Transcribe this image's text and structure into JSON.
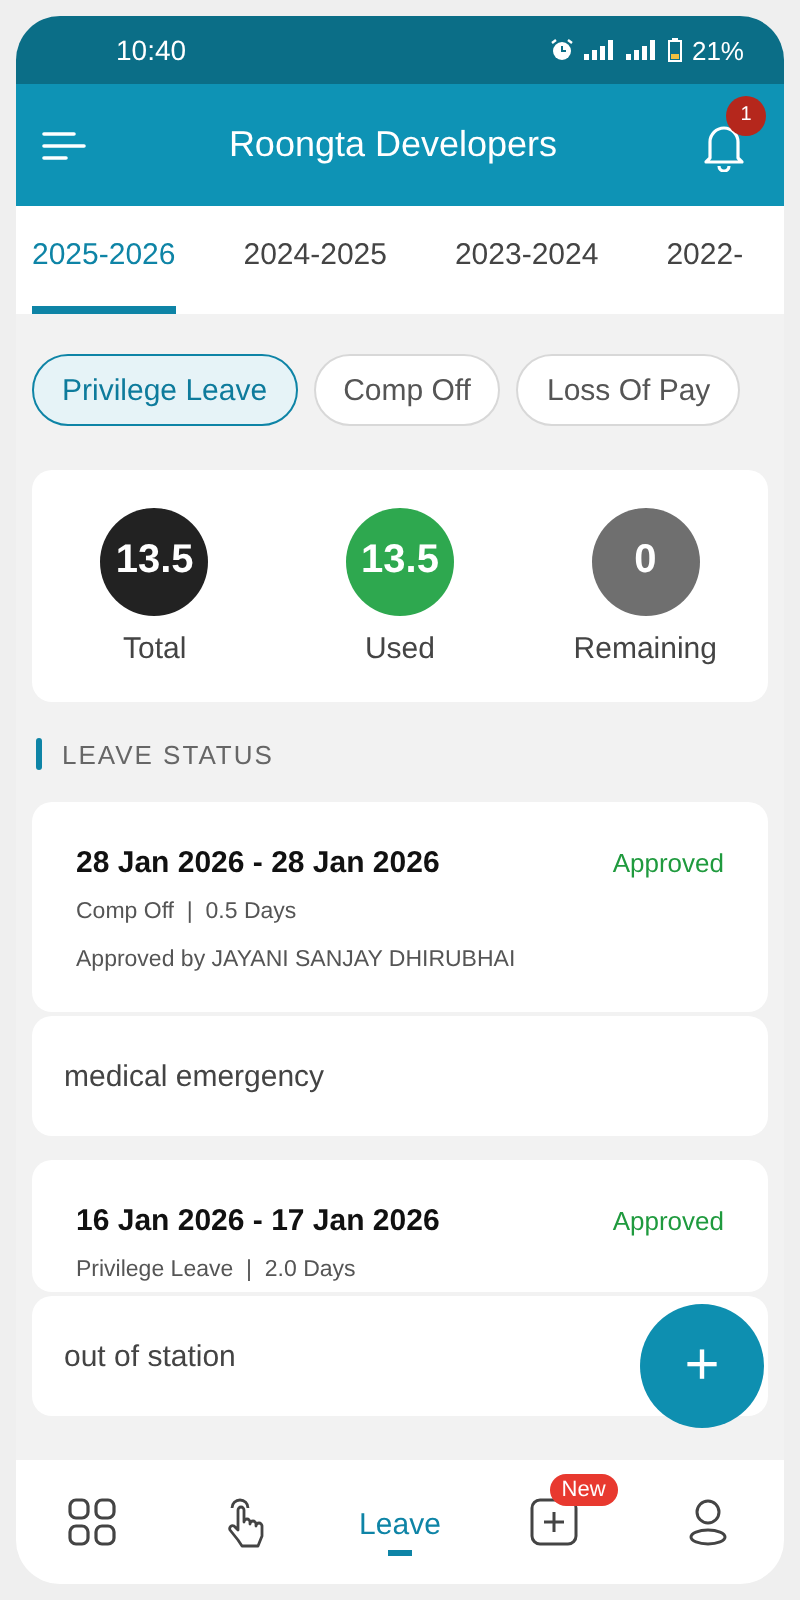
{
  "status_bar": {
    "time": "10:40",
    "battery": "21%"
  },
  "app_bar": {
    "title": "Roongta Developers",
    "notification_count": "1"
  },
  "tabs": [
    {
      "label": "2025-2026",
      "selected": true
    },
    {
      "label": "2024-2025",
      "selected": false
    },
    {
      "label": "2023-2024",
      "selected": false
    },
    {
      "label": "2022-",
      "selected": false
    }
  ],
  "filters": [
    {
      "label": "Privilege Leave",
      "selected": true
    },
    {
      "label": "Comp Off",
      "selected": false
    },
    {
      "label": "Loss Of Pay",
      "selected": false
    }
  ],
  "summary": [
    {
      "value": "13.5",
      "label": "Total",
      "color": "#222222"
    },
    {
      "value": "13.5",
      "label": "Used",
      "color": "#2ea84f"
    },
    {
      "value": "0",
      "label": "Remaining",
      "color": "#6f6f6f"
    }
  ],
  "section_title": "LEAVE STATUS",
  "leaves": [
    {
      "dates": "28 Jan 2026 - 28 Jan 2026",
      "status": "Approved",
      "color": "#1f9a3e",
      "details": "Comp Off  |  0.5 Days",
      "approved_by": "Approved by JAYANI SANJAY DHIRUBHAI",
      "reason": "medical emergency"
    },
    {
      "dates": "16 Jan 2026 - 17 Jan 2026",
      "status": "Approved",
      "color": "#1f9a3e",
      "details": "Privilege Leave  |  2.0 Days",
      "reason": "out of station"
    }
  ],
  "fab": {
    "label": "+"
  },
  "bottom_nav": [
    {
      "kind": "grid",
      "selected": false
    },
    {
      "kind": "tap",
      "selected": false
    },
    {
      "kind": "text",
      "label": "Leave",
      "selected": true
    },
    {
      "kind": "add",
      "badge": "New",
      "selected": false
    },
    {
      "kind": "profile",
      "selected": false
    }
  ]
}
